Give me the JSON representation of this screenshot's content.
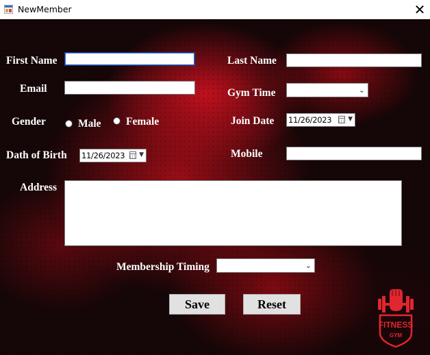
{
  "window": {
    "title": "NewMember",
    "close_glyph": "✕"
  },
  "labels": {
    "first_name": "First Name",
    "last_name": "Last Name",
    "email": "Email",
    "gym_time": "Gym Time",
    "gender": "Gender",
    "male": "Male",
    "female": "Female",
    "join_date": "Join Date",
    "date_of_birth": "Dath of Birth",
    "mobile": "Mobile",
    "address": "Address",
    "membership_timing": "Membership Timing"
  },
  "fields": {
    "first_name": "",
    "last_name": "",
    "email": "",
    "gym_time": "",
    "join_date": "11/26/2023",
    "date_of_birth": "11/26/2023",
    "mobile": "",
    "address": "",
    "membership_timing": ""
  },
  "buttons": {
    "save": "Save",
    "reset": "Reset"
  },
  "logo": {
    "line1": "FITNESS",
    "line2": "GYM"
  },
  "colors": {
    "accent_red": "#e0262f",
    "background_dark": "#150607"
  }
}
